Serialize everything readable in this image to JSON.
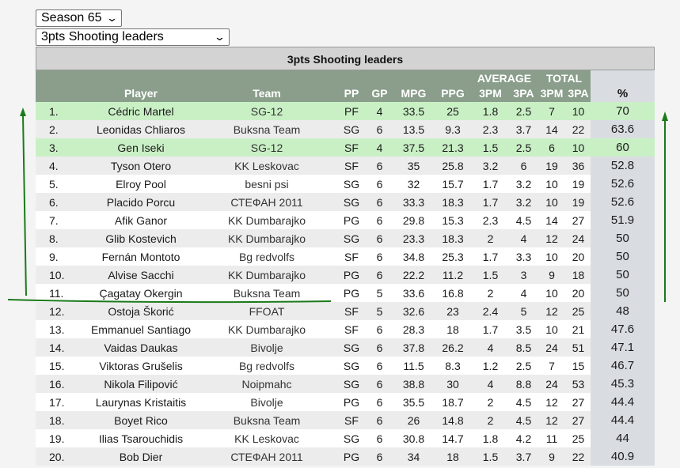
{
  "season_select": {
    "value": "Season 65"
  },
  "category_select": {
    "value": "3pts Shooting leaders"
  },
  "table": {
    "title": "3pts Shooting leaders",
    "group_headers": {
      "average": "AVERAGE",
      "total": "TOTAL"
    },
    "columns": [
      "Player",
      "Team",
      "PP",
      "GP",
      "MPG",
      "PPG",
      "3PM",
      "3PA",
      "3PM",
      "3PA",
      "%"
    ],
    "rows": [
      {
        "rank": "1.",
        "player": "Cédric Martel",
        "team": "SG-12",
        "pp": "PF",
        "gp": "4",
        "mpg": "33.5",
        "ppg": "25",
        "avg_3pm": "1.8",
        "avg_3pa": "2.5",
        "tot_3pm": "7",
        "tot_3pa": "10",
        "pct": "70",
        "highlight": true
      },
      {
        "rank": "2.",
        "player": "Leonidas Chliaros",
        "team": "Buksna Team",
        "pp": "SG",
        "gp": "6",
        "mpg": "13.5",
        "ppg": "9.3",
        "avg_3pm": "2.3",
        "avg_3pa": "3.7",
        "tot_3pm": "14",
        "tot_3pa": "22",
        "pct": "63.6",
        "highlight": false
      },
      {
        "rank": "3.",
        "player": "Gen Iseki",
        "team": "SG-12",
        "pp": "SF",
        "gp": "4",
        "mpg": "37.5",
        "ppg": "21.3",
        "avg_3pm": "1.5",
        "avg_3pa": "2.5",
        "tot_3pm": "6",
        "tot_3pa": "10",
        "pct": "60",
        "highlight": true
      },
      {
        "rank": "4.",
        "player": "Tyson Otero",
        "team": "KK Leskovac",
        "pp": "SF",
        "gp": "6",
        "mpg": "35",
        "ppg": "25.8",
        "avg_3pm": "3.2",
        "avg_3pa": "6",
        "tot_3pm": "19",
        "tot_3pa": "36",
        "pct": "52.8",
        "highlight": false
      },
      {
        "rank": "5.",
        "player": "Elroy Pool",
        "team": "besni psi",
        "pp": "SG",
        "gp": "6",
        "mpg": "32",
        "ppg": "15.7",
        "avg_3pm": "1.7",
        "avg_3pa": "3.2",
        "tot_3pm": "10",
        "tot_3pa": "19",
        "pct": "52.6",
        "highlight": false
      },
      {
        "rank": "6.",
        "player": "Placido Porcu",
        "team": "СТЕФАН 2011",
        "pp": "SG",
        "gp": "6",
        "mpg": "33.3",
        "ppg": "18.3",
        "avg_3pm": "1.7",
        "avg_3pa": "3.2",
        "tot_3pm": "10",
        "tot_3pa": "19",
        "pct": "52.6",
        "highlight": false
      },
      {
        "rank": "7.",
        "player": "Afik Ganor",
        "team": "KK Dumbarajko",
        "pp": "PG",
        "gp": "6",
        "mpg": "29.8",
        "ppg": "15.3",
        "avg_3pm": "2.3",
        "avg_3pa": "4.5",
        "tot_3pm": "14",
        "tot_3pa": "27",
        "pct": "51.9",
        "highlight": false
      },
      {
        "rank": "8.",
        "player": "Glib Kostevich",
        "team": "KK Dumbarajko",
        "pp": "SG",
        "gp": "6",
        "mpg": "23.3",
        "ppg": "18.3",
        "avg_3pm": "2",
        "avg_3pa": "4",
        "tot_3pm": "12",
        "tot_3pa": "24",
        "pct": "50",
        "highlight": false
      },
      {
        "rank": "9.",
        "player": "Fernán Montoto",
        "team": "Bg redvolfs",
        "pp": "SF",
        "gp": "6",
        "mpg": "34.8",
        "ppg": "25.3",
        "avg_3pm": "1.7",
        "avg_3pa": "3.3",
        "tot_3pm": "10",
        "tot_3pa": "20",
        "pct": "50",
        "highlight": false
      },
      {
        "rank": "10.",
        "player": "Alvise Sacchi",
        "team": "KK Dumbarajko",
        "pp": "PG",
        "gp": "6",
        "mpg": "22.2",
        "ppg": "11.2",
        "avg_3pm": "1.5",
        "avg_3pa": "3",
        "tot_3pm": "9",
        "tot_3pa": "18",
        "pct": "50",
        "highlight": false
      },
      {
        "rank": "11.",
        "player": "Çagatay Okergin",
        "team": "Buksna Team",
        "pp": "PG",
        "gp": "5",
        "mpg": "33.6",
        "ppg": "16.8",
        "avg_3pm": "2",
        "avg_3pa": "4",
        "tot_3pm": "10",
        "tot_3pa": "20",
        "pct": "50",
        "highlight": false
      },
      {
        "rank": "12.",
        "player": "Ostoja Škorić",
        "team": "FFOAT",
        "pp": "SF",
        "gp": "5",
        "mpg": "32.6",
        "ppg": "23",
        "avg_3pm": "2.4",
        "avg_3pa": "5",
        "tot_3pm": "12",
        "tot_3pa": "25",
        "pct": "48",
        "highlight": false
      },
      {
        "rank": "13.",
        "player": "Emmanuel Santiago",
        "team": "KK Dumbarajko",
        "pp": "SF",
        "gp": "6",
        "mpg": "28.3",
        "ppg": "18",
        "avg_3pm": "1.7",
        "avg_3pa": "3.5",
        "tot_3pm": "10",
        "tot_3pa": "21",
        "pct": "47.6",
        "highlight": false
      },
      {
        "rank": "14.",
        "player": "Vaidas Daukas",
        "team": "Bivolje",
        "pp": "SG",
        "gp": "6",
        "mpg": "37.8",
        "ppg": "26.2",
        "avg_3pm": "4",
        "avg_3pa": "8.5",
        "tot_3pm": "24",
        "tot_3pa": "51",
        "pct": "47.1",
        "highlight": false
      },
      {
        "rank": "15.",
        "player": "Viktoras Grušelis",
        "team": "Bg redvolfs",
        "pp": "SG",
        "gp": "6",
        "mpg": "11.5",
        "ppg": "8.3",
        "avg_3pm": "1.2",
        "avg_3pa": "2.5",
        "tot_3pm": "7",
        "tot_3pa": "15",
        "pct": "46.7",
        "highlight": false
      },
      {
        "rank": "16.",
        "player": "Nikola Filipović",
        "team": "Noipmahc",
        "pp": "SG",
        "gp": "6",
        "mpg": "38.8",
        "ppg": "30",
        "avg_3pm": "4",
        "avg_3pa": "8.8",
        "tot_3pm": "24",
        "tot_3pa": "53",
        "pct": "45.3",
        "highlight": false
      },
      {
        "rank": "17.",
        "player": "Laurynas Kristaitis",
        "team": "Bivolje",
        "pp": "PG",
        "gp": "6",
        "mpg": "35.5",
        "ppg": "18.7",
        "avg_3pm": "2",
        "avg_3pa": "4.5",
        "tot_3pm": "12",
        "tot_3pa": "27",
        "pct": "44.4",
        "highlight": false
      },
      {
        "rank": "18.",
        "player": "Boyet Rico",
        "team": "Buksna Team",
        "pp": "SF",
        "gp": "6",
        "mpg": "26",
        "ppg": "14.8",
        "avg_3pm": "2",
        "avg_3pa": "4.5",
        "tot_3pm": "12",
        "tot_3pa": "27",
        "pct": "44.4",
        "highlight": false
      },
      {
        "rank": "19.",
        "player": "Ilias Tsarouchidis",
        "team": "KK Leskovac",
        "pp": "SG",
        "gp": "6",
        "mpg": "30.8",
        "ppg": "14.7",
        "avg_3pm": "1.8",
        "avg_3pa": "4.2",
        "tot_3pm": "11",
        "tot_3pa": "25",
        "pct": "44",
        "highlight": false
      },
      {
        "rank": "20.",
        "player": "Bob Dier",
        "team": "СТЕФАН 2011",
        "pp": "PG",
        "gp": "6",
        "mpg": "34",
        "ppg": "18",
        "avg_3pm": "1.5",
        "avg_3pa": "3.7",
        "tot_3pm": "9",
        "tot_3pa": "22",
        "pct": "40.9",
        "highlight": false
      }
    ]
  },
  "annotation": {
    "color": "#1a7a1a"
  }
}
